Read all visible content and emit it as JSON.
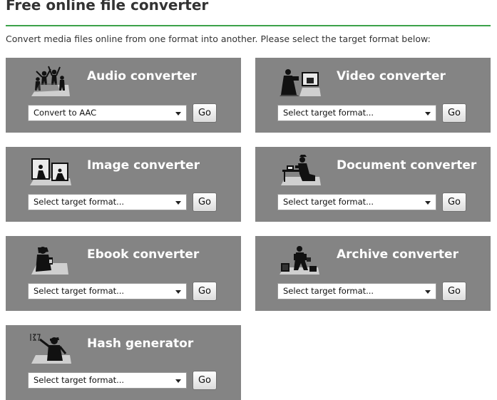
{
  "page": {
    "title": "Free online file converter",
    "intro": "Convert media files online from one format into another. Please select the target format below:",
    "accent_color": "#3ca24a",
    "card_color": "#848484"
  },
  "converters": [
    {
      "name": "Audio converter",
      "select_value": "Convert to AAC",
      "go_label": "Go",
      "icon": "dancing-people-icon"
    },
    {
      "name": "Video converter",
      "select_value": "Select target format...",
      "go_label": "Go",
      "icon": "video-screen-icon"
    },
    {
      "name": "Image converter",
      "select_value": "Select target format...",
      "go_label": "Go",
      "icon": "photo-frames-icon"
    },
    {
      "name": "Document converter",
      "select_value": "Select target format...",
      "go_label": "Go",
      "icon": "person-at-desk-icon"
    },
    {
      "name": "Ebook converter",
      "select_value": "Select target format...",
      "go_label": "Go",
      "icon": "person-reading-ebook-icon"
    },
    {
      "name": "Archive converter",
      "select_value": "Select target format...",
      "go_label": "Go",
      "icon": "person-with-boxes-icon"
    },
    {
      "name": "Hash generator",
      "select_value": "Select target format...",
      "go_label": "Go",
      "icon": "person-with-hash-icon"
    }
  ]
}
